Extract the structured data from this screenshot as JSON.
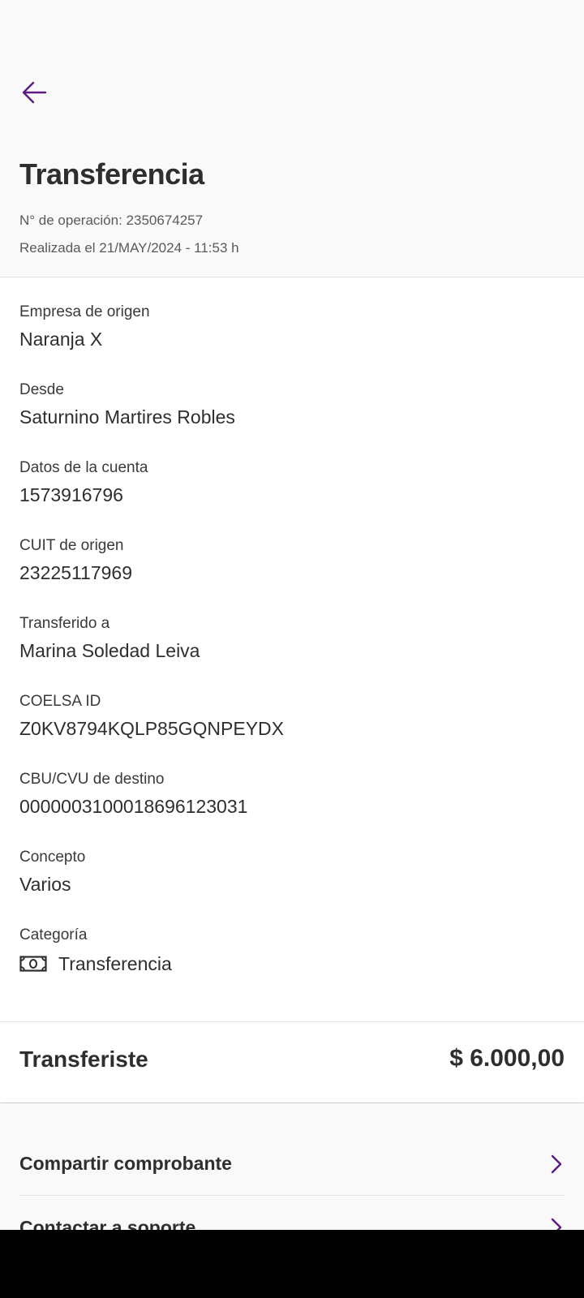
{
  "accent_color": "#5c1a7e",
  "header": {
    "back_icon": "arrow-left-icon",
    "title": "Transferencia",
    "operation": "N° de operación: 2350674257",
    "date": "Realizada el 21/MAY/2024 - 11:53 h"
  },
  "details": [
    {
      "label": "Empresa de origen",
      "value": "Naranja X"
    },
    {
      "label": "Desde",
      "value": "Saturnino Martires Robles"
    },
    {
      "label": "Datos de la cuenta",
      "value": "1573916796"
    },
    {
      "label": "CUIT de origen",
      "value": "23225117969"
    },
    {
      "label": "Transferido a",
      "value": "Marina Soledad Leiva"
    },
    {
      "label": "COELSA ID",
      "value": "Z0KV8794KQLP85GQNPEYDX"
    },
    {
      "label": "CBU/CVU de destino",
      "value": "0000003100018696123031"
    },
    {
      "label": "Concepto",
      "value": "Varios"
    }
  ],
  "category": {
    "label": "Categoría",
    "icon": "money-bill-icon",
    "value": "Transferencia"
  },
  "summary": {
    "label": "Transferiste",
    "amount": "$ 6.000,00"
  },
  "actions": [
    {
      "label": "Compartir comprobante",
      "icon": "chevron-right-icon"
    },
    {
      "label": "Contactar a soporte",
      "icon": "chevron-right-icon"
    }
  ]
}
